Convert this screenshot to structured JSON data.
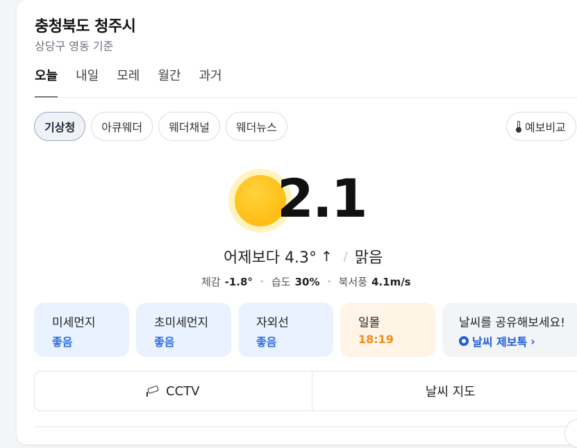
{
  "location": {
    "title": "충청북도 청주시",
    "subtitle": "상당구 영동 기준"
  },
  "tabs": [
    {
      "label": "오늘",
      "active": true
    },
    {
      "label": "내일"
    },
    {
      "label": "모레"
    },
    {
      "label": "월간"
    },
    {
      "label": "과거"
    }
  ],
  "sources": [
    {
      "label": "기상청",
      "active": true
    },
    {
      "label": "아큐웨더"
    },
    {
      "label": "웨더채널"
    },
    {
      "label": "웨더뉴스"
    }
  ],
  "compare_label": "예보비교",
  "current": {
    "temperature": "2.1",
    "unit": "°",
    "compare_text": "어제보다 4.3°",
    "compare_arrow": "↑",
    "slash": "/",
    "condition": "맑음",
    "feels_label": "체감",
    "feels_value": "-1.8°",
    "humidity_label": "습도",
    "humidity_value": "30%",
    "wind_label": "북서풍",
    "wind_value": "4.1m/s",
    "separator": "•"
  },
  "info_cards": [
    {
      "label": "미세먼지",
      "value": "좋음"
    },
    {
      "label": "초미세먼지",
      "value": "좋음"
    },
    {
      "label": "자외선",
      "value": "좋음"
    },
    {
      "label": "일몰",
      "value": "18:19"
    }
  ],
  "share": {
    "label": "날씨를 공유해보세요!",
    "link": "날씨 제보톡",
    "chevron": "›"
  },
  "bottom": {
    "cctv": "CCTV",
    "map": "날씨 지도"
  },
  "colors": {
    "good": "#2f6fe0",
    "sunset": "#f08c1a",
    "link": "#1e5dd8"
  },
  "icons": {
    "weather": "sun-icon",
    "cctv": "cctv-icon",
    "compare": "thermometer-icon",
    "share": "chat-icon"
  }
}
